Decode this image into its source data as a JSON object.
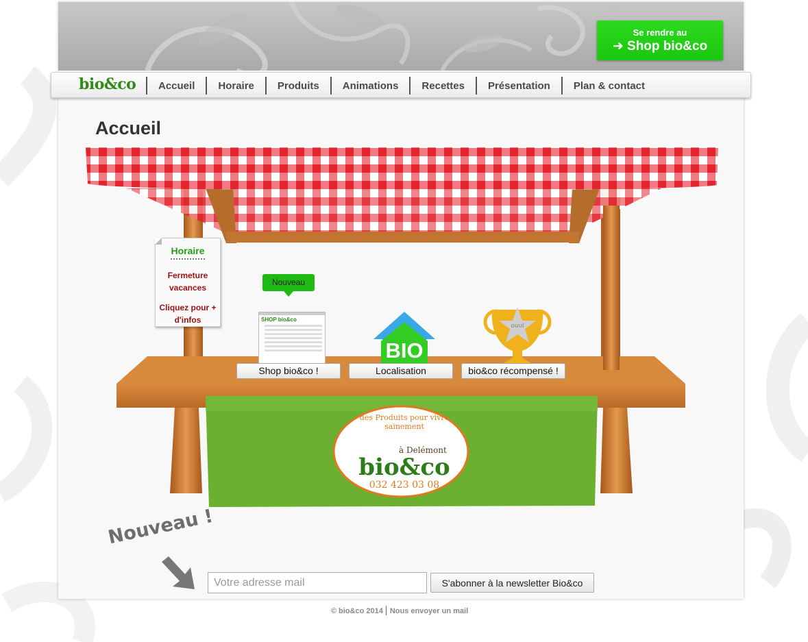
{
  "banner": {
    "cta_small": "Se rendre au",
    "cta_big": "Shop bio&co",
    "cta_arrow": "➜"
  },
  "nav": {
    "logo": "bio&co",
    "items": [
      "Accueil",
      "Horaire",
      "Produits",
      "Animations",
      "Recettes",
      "Présentation",
      "Plan & contact"
    ]
  },
  "main": {
    "title": "Accueil",
    "horaire_card": {
      "title": "Horaire",
      "line1": "Fermeture vacances",
      "line2": "Cliquez pour + d'infos"
    },
    "new_tooltip": "Nouveau",
    "shop_thumb_brand": "SHOP bio&co",
    "bio_label": "BIO",
    "trophy_label": "ouul",
    "buttons": {
      "shop": "Shop bio&co !",
      "location": "Localisation",
      "award": "bio&co récompensé !"
    },
    "sign": {
      "arc_text": "des Produits pour vivre sainement",
      "town": "à Delémont",
      "brand": "bio&co",
      "phone": "032 423 03 08"
    }
  },
  "newsletter": {
    "nouveau_label": "Nouveau !",
    "email_placeholder": "Votre adresse mail",
    "email_value": "",
    "subscribe_label": "S'abonner à la newsletter Bio&co"
  },
  "footer": {
    "copyright": "© bio&co 2014",
    "mail_link": "Nous envoyer un mail"
  },
  "colors": {
    "brand_green": "#1fc514",
    "nav_text": "#4a4a4a",
    "banner_green": "#6fb43a",
    "awning_red": "#e8323c",
    "wood": "#c8772e"
  }
}
